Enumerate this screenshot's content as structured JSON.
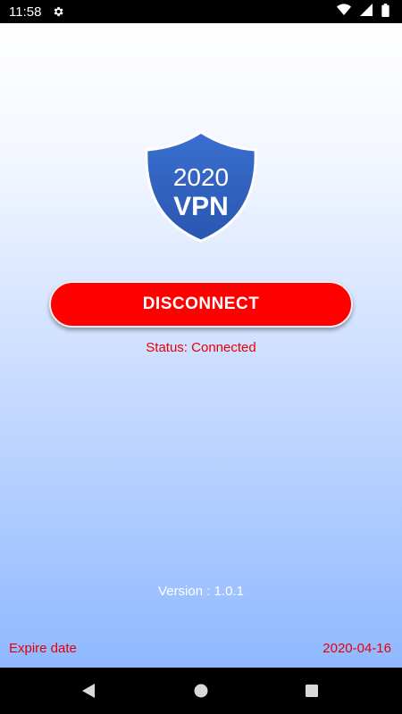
{
  "status_bar": {
    "time": "11:58",
    "icons": [
      "gear-icon",
      "wifi-icon",
      "signal-icon",
      "battery-icon"
    ]
  },
  "logo": {
    "year": "2020",
    "name": "VPN",
    "shield_color": "#2e5fbf"
  },
  "main": {
    "disconnect_label": "DISCONNECT",
    "status_text": "Status: Connected",
    "version_text": "Version : 1.0.1",
    "expire_label": "Expire date",
    "expire_value": "2020-04-16"
  },
  "colors": {
    "accent_red": "#ff0000",
    "status_red": "#e80000",
    "gradient_bottom": "#8fb8ff"
  },
  "nav_bar": {
    "buttons": [
      "back-icon",
      "home-icon",
      "recents-icon"
    ]
  }
}
